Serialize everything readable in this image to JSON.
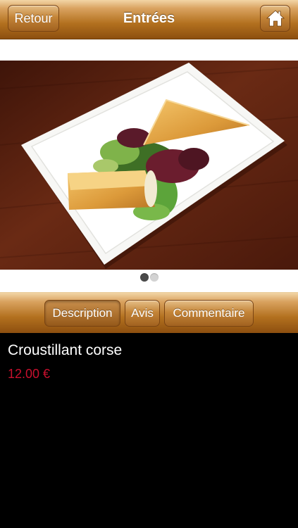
{
  "header": {
    "back_label": "Retour",
    "title": "Entrées",
    "home_icon": "home-icon"
  },
  "gallery": {
    "page_count": 2,
    "current_page": 1,
    "image": "plated-dish-photo"
  },
  "tabs": [
    {
      "label": "Description",
      "selected": true
    },
    {
      "label": "Avis",
      "selected": false
    },
    {
      "label": "Commentaire",
      "selected": false
    }
  ],
  "dish": {
    "name": "Croustillant corse",
    "price": "12.00 €"
  },
  "colors": {
    "bar_brown": "#b3711f",
    "price_red": "#c8102e",
    "background": "#000000"
  }
}
